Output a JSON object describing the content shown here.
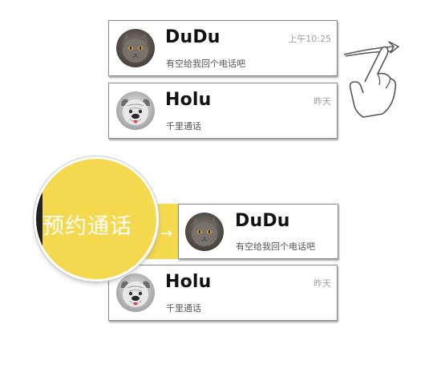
{
  "contacts": {
    "dudu": {
      "name": "DuDu",
      "message": "有空给我回个电话吧",
      "time": "上午10:25"
    },
    "holu": {
      "name": "Holu",
      "message": "千里通话",
      "time": "昨天"
    }
  },
  "swipe_action": {
    "label": "预约通话",
    "arrow": "→"
  },
  "icons": {
    "gesture": "swipe-hand-icon",
    "cat_avatar": "cat-avatar",
    "dog_avatar": "bulldog-avatar"
  },
  "colors": {
    "action_yellow": "#f4d84e",
    "card_border": "#8a8a8a",
    "time_gray": "#a0a0a0"
  }
}
